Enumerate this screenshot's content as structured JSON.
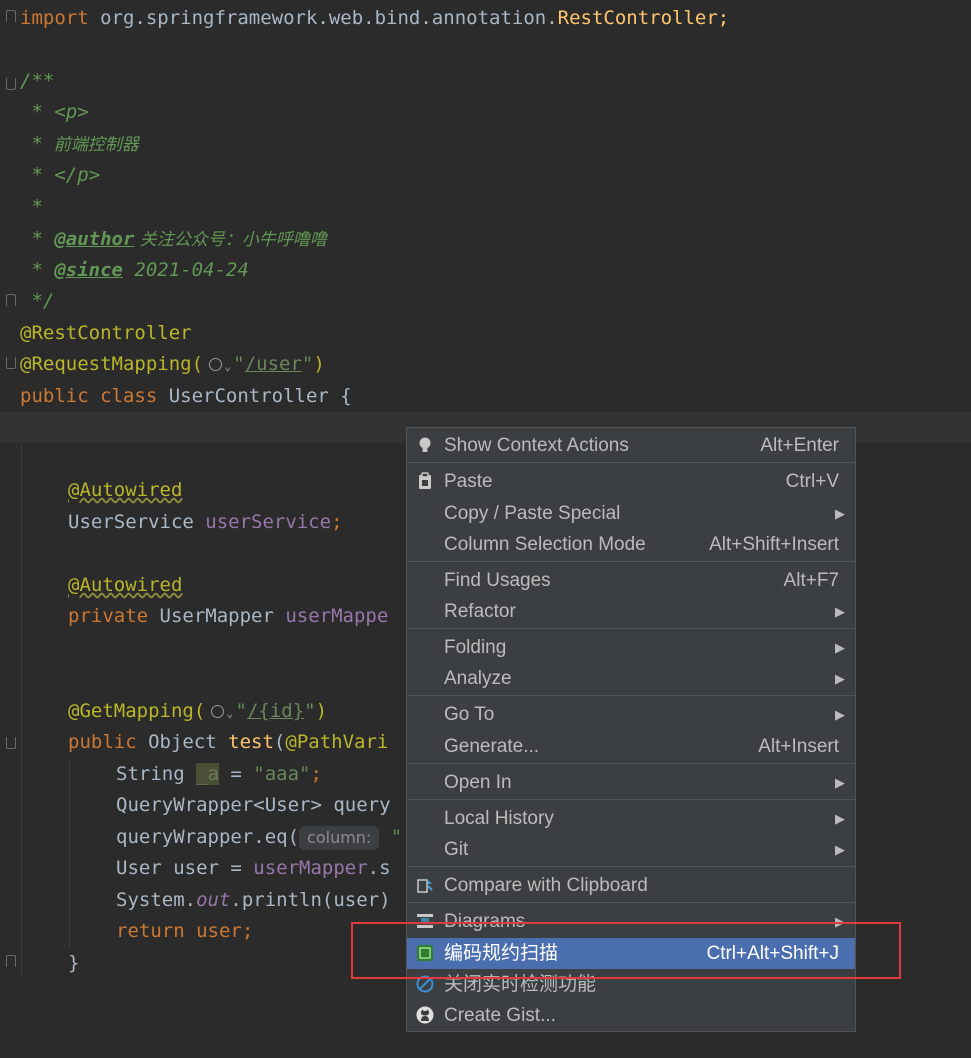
{
  "code": {
    "import_kw": "import",
    "import_pkg": " org.springframework.web.bind.annotation.",
    "import_cls": "RestController;",
    "doc_open": "/**",
    "doc_p_open": " * <p>",
    "doc_desc_star": " *",
    "doc_desc": "  前端控制器",
    "doc_p_close": " * </p>",
    "doc_blank": " *",
    "doc_author_star": " * ",
    "doc_author_tag": "@author",
    "doc_author_val": " 关注公众号：小牛呼噜噜",
    "doc_since_star": " * ",
    "doc_since_tag": "@since",
    "doc_since_val": " 2021-04-24",
    "doc_close": " */",
    "ann_rest": "@RestController",
    "ann_reqmap": "@RequestMapping(",
    "reqmap_quote_open": "\"",
    "reqmap_path": "/user",
    "reqmap_quote_close": "\"",
    "reqmap_close": ")",
    "class_kw1": "public",
    "class_kw2": " class",
    "class_name": " UserController {",
    "ann_autowired1": "@Autowired",
    "svc_type": "UserService ",
    "svc_field": "userService",
    "svc_semi": ";",
    "ann_autowired2": "@Autowired",
    "mapper_kw": "private",
    "mapper_type": " UserMapper ",
    "mapper_field": "userMappe",
    "ann_getmap": "@GetMapping(",
    "getmap_quote_open": "\"",
    "getmap_path": "/{id}",
    "getmap_quote_close": "\"",
    "getmap_close": ")",
    "test_kw": "public",
    "test_type": " Object ",
    "test_fn": "test",
    "test_args": "(",
    "test_ann": "@PathVari",
    "line_string_type": "String ",
    "line_string_var": "_a",
    "line_string_eq": " = ",
    "line_string_val": "\"aaa\"",
    "line_string_semi": ";",
    "line_qw": "QueryWrapper<User> query",
    "line_eq_call": "queryWrapper.eq(",
    "line_eq_hint": "column:",
    "line_eq_rest": " \"",
    "line_user_decl": "User user = ",
    "line_user_field": "userMapper",
    "line_user_rest": ".s",
    "line_sys": "System.",
    "line_sys_out": "out",
    "line_sys_rest": ".println(user)",
    "line_return_kw": "return",
    "line_return_rest": " user;",
    "line_close_brace": "}"
  },
  "menu": {
    "items": [
      {
        "label": "Show Context Actions",
        "shortcut": "Alt+Enter",
        "icon": "lightbulb-icon"
      },
      {
        "label": "Paste",
        "shortcut": "Ctrl+V",
        "icon": "clipboard-icon"
      },
      {
        "label": "Copy / Paste Special",
        "shortcut": "",
        "submenu": true
      },
      {
        "label": "Column Selection Mode",
        "shortcut": "Alt+Shift+Insert"
      },
      {
        "label": "Find Usages",
        "shortcut": "Alt+F7"
      },
      {
        "label": "Refactor",
        "shortcut": "",
        "submenu": true
      },
      {
        "label": "Folding",
        "shortcut": "",
        "submenu": true
      },
      {
        "label": "Analyze",
        "shortcut": "",
        "submenu": true
      },
      {
        "label": "Go To",
        "shortcut": "",
        "submenu": true
      },
      {
        "label": "Generate...",
        "shortcut": "Alt+Insert"
      },
      {
        "label": "Open In",
        "shortcut": "",
        "submenu": true
      },
      {
        "label": "Local History",
        "shortcut": "",
        "submenu": true
      },
      {
        "label": "Git",
        "shortcut": "",
        "submenu": true
      },
      {
        "label": "Compare with Clipboard",
        "shortcut": "",
        "icon": "compare-icon"
      },
      {
        "label": "Diagrams",
        "shortcut": "",
        "submenu": true,
        "icon": "diagram-icon"
      },
      {
        "label": "编码规约扫描",
        "shortcut": "Ctrl+Alt+Shift+J",
        "selected": true,
        "icon": "scan-icon"
      },
      {
        "label": "关闭实时检测功能",
        "shortcut": "",
        "icon": "disable-icon"
      },
      {
        "label": "Create Gist...",
        "shortcut": "",
        "icon": "github-icon"
      }
    ],
    "arrow_glyph": "▶"
  },
  "colors": {
    "editor_bg": "#2b2b2b",
    "menu_bg": "#3c3f41",
    "selection": "#4b6eaf",
    "highlight_box": "#e0393e"
  }
}
